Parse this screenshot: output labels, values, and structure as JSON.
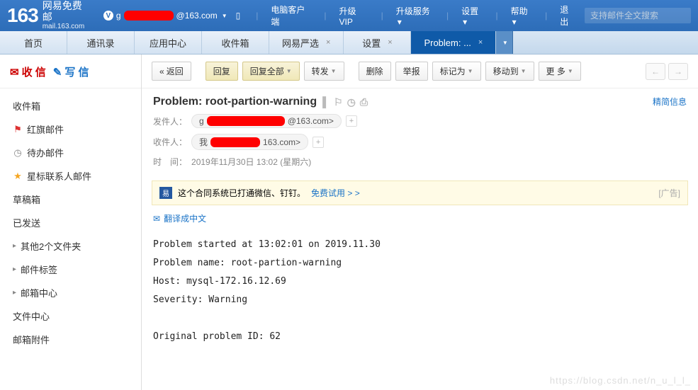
{
  "header": {
    "logo_num": "163",
    "logo_cn": "网易免费邮",
    "logo_en": "mail.163.com",
    "user_suffix": "@163.com",
    "nav": [
      "电脑客户端",
      "升级VIP",
      "升级服务",
      "设置",
      "帮助",
      "退出"
    ],
    "search_placeholder": "支持邮件全文搜索"
  },
  "tabs": [
    {
      "label": "首页",
      "close": false
    },
    {
      "label": "通讯录",
      "close": false
    },
    {
      "label": "应用中心",
      "close": false
    },
    {
      "label": "收件箱",
      "close": false
    },
    {
      "label": "网易严选",
      "close": true
    },
    {
      "label": "设置",
      "close": true
    },
    {
      "label": "Problem: ...",
      "close": true,
      "active": true
    }
  ],
  "sidebar": {
    "receive": "收 信",
    "compose": "写 信",
    "folders": [
      {
        "label": "收件箱"
      },
      {
        "label": "红旗邮件",
        "icon": "flag"
      },
      {
        "label": "待办邮件",
        "icon": "clock"
      },
      {
        "label": "星标联系人邮件",
        "icon": "star"
      },
      {
        "label": "草稿箱"
      },
      {
        "label": "已发送"
      },
      {
        "label": "其他2个文件夹",
        "caret": true
      },
      {
        "label": "邮件标签",
        "caret": true
      },
      {
        "label": "邮箱中心",
        "caret": true
      },
      {
        "label": "文件中心"
      },
      {
        "label": "邮箱附件"
      }
    ]
  },
  "toolbar": {
    "back": "返回",
    "reply": "回复",
    "reply_all": "回复全部",
    "forward": "转发",
    "delete": "删除",
    "report": "举报",
    "mark": "标记为",
    "move": "移动到",
    "more": "更 多"
  },
  "message": {
    "subject": "Problem: root-partion-warning",
    "simple": "精简信息",
    "from_label": "发件人：",
    "from_suffix": "@163.com>",
    "to_label": "收件人：",
    "to_prefix": "我",
    "to_suffix": "163.com>",
    "time_label": "时　间：",
    "time_value": "2019年11月30日 13:02 (星期六)"
  },
  "promo": {
    "text": "这个合同系统已打通微信、钉钉。",
    "link": "免费试用 > >",
    "ad": "[广告]"
  },
  "translate": "翻译成中文",
  "body_lines": [
    "Problem started at 13:02:01 on 2019.11.30",
    "Problem name: root-partion-warning",
    "Host: mysql-172.16.12.69",
    "Severity: Warning",
    "",
    "Original problem ID: 62"
  ],
  "watermark": "https://blog.csdn.net/n_u_l_l_"
}
